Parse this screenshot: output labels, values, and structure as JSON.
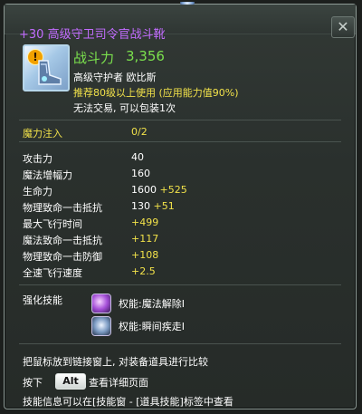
{
  "item": {
    "name": "+30 高级守卫司令官战斗靴",
    "icon": "boots-item-icon",
    "warning_icon": "exclamation-icon",
    "power_label": "战斗力",
    "power_value": "3,356",
    "line1": "高级守护者 欧比斯",
    "line2": "推荐80级以上使用 (应用能力值90%)",
    "line3": "无法交易, 可以包装1次"
  },
  "close_button": {
    "label": "✕",
    "icon": "close-icon"
  },
  "mana": {
    "label": "魔力注入",
    "value": "0/2"
  },
  "stats": [
    {
      "label": "攻击力",
      "base": "40",
      "bonus": ""
    },
    {
      "label": "魔法增幅力",
      "base": "160",
      "bonus": ""
    },
    {
      "label": "生命力",
      "base": "1600",
      "bonus": "+525"
    },
    {
      "label": "物理致命一击抵抗",
      "base": "130",
      "bonus": "+51"
    },
    {
      "label": "最大飞行时间",
      "base": "",
      "bonus": "+499"
    },
    {
      "label": "魔法致命一击抵抗",
      "base": "",
      "bonus": "+117"
    },
    {
      "label": "物理致命一击防御",
      "base": "",
      "bonus": "+108"
    },
    {
      "label": "全速飞行速度",
      "base": "",
      "bonus": "+2.5"
    }
  ],
  "enhance": {
    "label": "强化技能",
    "skills": [
      {
        "name": "权能:魔法解除I",
        "icon": "magic-dispel-skill-icon"
      },
      {
        "name": "权能:瞬间疾走I",
        "icon": "instant-dash-skill-icon"
      }
    ]
  },
  "footer": {
    "compare_text": "把鼠标放到链接窗上, 对装备道具进行比较",
    "press": "按下",
    "key": "Alt",
    "view_detail": "查看详细页面",
    "skill_info": "技能信息可以在[技能窗 - [道具技能]标签中查看"
  },
  "colors": {
    "name": "#c26cff",
    "power": "#7be14d",
    "recommend": "#f2e24a",
    "mana_value": "#f2e24a",
    "bonus": "#f2e24a"
  }
}
